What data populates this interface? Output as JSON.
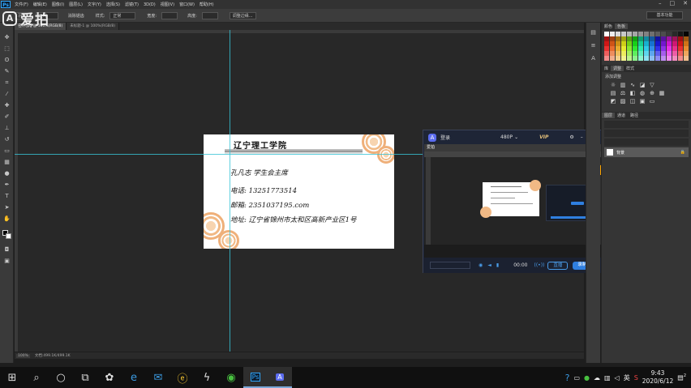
{
  "app": {
    "logo": "Ps",
    "menus": [
      "文件(F)",
      "编辑(E)",
      "图像(I)",
      "图层(L)",
      "文字(Y)",
      "选择(S)",
      "滤镜(T)",
      "3D(D)",
      "视图(V)",
      "窗口(W)",
      "帮助(H)"
    ],
    "window_controls": [
      "–",
      "□",
      "✕"
    ]
  },
  "options": {
    "mode_value": "正常",
    "style_label": "样式:",
    "style_value": "正常",
    "width_label": "宽度:",
    "height_label": "高度:",
    "refine_button": "调整边缘...",
    "feather_label": "羽化:",
    "antialias_label": "消除锯齿",
    "workspace": "基本功能"
  },
  "tabs": [
    {
      "label": "名片.jpg @ 100%(RGB/8)",
      "active": true
    },
    {
      "label": "未标题-1 @ 100%(RGB/8)",
      "active": false
    }
  ],
  "status": {
    "zoom": "100%",
    "doc": "文档:499.1K/499.1K"
  },
  "card": {
    "title": "辽宁理工学院",
    "name_line": "孔凡志          学生会主席",
    "phone_line": "电话: 13251773514",
    "email_line": "邮箱: 2351037195.com",
    "address_line": "地址: 辽宁省锦州市太和区高新产业区1号"
  },
  "recorder": {
    "logo": "A",
    "login": "登录",
    "quality": "480P",
    "vip": "VIP",
    "brand": "爱拍",
    "timer": "00:00",
    "live_button": "直播",
    "record_button": "录制"
  },
  "panels": {
    "color_tab": "颜色",
    "swatches_tab": "色板",
    "library_tab": "库",
    "adjust_tab": "调整",
    "style_tab": "样式",
    "adjust_header": "添加调整",
    "layers_tab": "图层",
    "channels_tab": "通道",
    "paths_tab": "路径",
    "layer_name": "背景"
  },
  "watermark": {
    "icon": "A",
    "text": "爱拍"
  },
  "taskbar": {
    "tray_lang": "英",
    "time": "9:43",
    "date": "2020/6/12",
    "notif_count": "2"
  },
  "colors": {
    "accent_blue": "#2f7fe0",
    "guide": "#37c3d6",
    "rose": "#efb07a"
  }
}
